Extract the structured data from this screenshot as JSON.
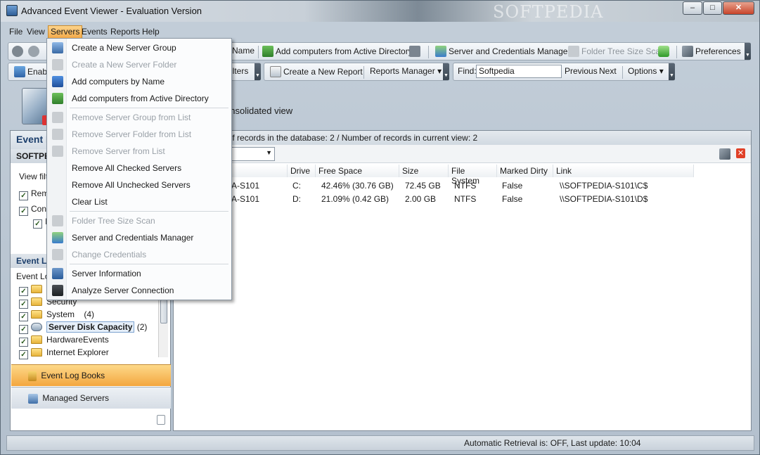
{
  "window": {
    "title": "Advanced Event Viewer - Evaluation Version",
    "watermark": "SOFTPEDIA",
    "buttons": {
      "minimize": "–",
      "maximize": "□",
      "close": "✕"
    }
  },
  "menubar": {
    "items": [
      "File",
      "View",
      "Servers",
      "Events",
      "Reports",
      "Help"
    ],
    "active": "Servers"
  },
  "toolbar1": {
    "name_label": "Name",
    "add_ad": "Add computers from Active Directory",
    "server_cred": "Server and Credentials Manager",
    "folder_scan": "Folder Tree Size Scan",
    "preferences": "Preferences"
  },
  "toolbar2": {
    "enable": "Enable",
    "filters": "ilters",
    "create_report": "Create a New Report",
    "reports_manager": "Reports Manager",
    "find_label": "Find:",
    "find_value": "Softpedia",
    "previous": "Previous",
    "next": "Next",
    "options": "Options"
  },
  "header": {
    "text": "onsolidated view"
  },
  "left": {
    "title": "Event L",
    "subtitle": "SOFTPEDI",
    "view_filter": "View filte",
    "cb1": "Reme",
    "cb2": "Cons",
    "cb3": "I",
    "section": "Event Lo",
    "log_label": "Event Log",
    "tree": [
      {
        "label": "A",
        "count": ""
      },
      {
        "label": "Security",
        "count": ""
      },
      {
        "label": "System",
        "count": "(4)"
      },
      {
        "label": "Server Disk Capacity",
        "count": "(2)"
      },
      {
        "label": "HardwareEvents",
        "count": ""
      },
      {
        "label": "Internet Explorer",
        "count": ""
      }
    ],
    "nav_books": "Event Log Books",
    "nav_servers": "Managed Servers"
  },
  "main": {
    "info": "city:   Number of records in the database: 2 / Number of records in current view: 2",
    "columns": [
      "Drive",
      "Free Space",
      "Size",
      "File System",
      "Marked Dirty",
      "Link"
    ],
    "rows": [
      {
        "server": "DIA-S101",
        "drive": "C:",
        "free": "42.46% (30.76 GB)",
        "size": "72.45 GB",
        "fs": "NTFS",
        "dirty": "False",
        "link": "\\\\SOFTPEDIA-S101\\C$"
      },
      {
        "server": "DIA-S101",
        "drive": "D:",
        "free": "21.09% (0.42 GB)",
        "size": "2.00 GB",
        "fs": "NTFS",
        "dirty": "False",
        "link": "\\\\SOFTPEDIA-S101\\D$"
      }
    ]
  },
  "status": {
    "text": "Automatic Retrieval is: OFF, Last update: 10:04"
  },
  "menu": {
    "items": [
      {
        "label": "Create a New Server Group",
        "disabled": false
      },
      {
        "label": "Create a New Server Folder",
        "disabled": true
      },
      {
        "label": "Add computers by Name",
        "disabled": false
      },
      {
        "label": "Add computers from Active Directory",
        "disabled": false
      },
      {
        "label": "Remove Server Group from List",
        "disabled": true
      },
      {
        "label": "Remove Server Folder from List",
        "disabled": true
      },
      {
        "label": "Remove Server from List",
        "disabled": true
      },
      {
        "label": "Remove All Checked Servers",
        "disabled": false
      },
      {
        "label": "Remove All Unchecked Servers",
        "disabled": false
      },
      {
        "label": "Clear List",
        "disabled": false
      },
      {
        "label": "Folder Tree Size Scan",
        "disabled": true
      },
      {
        "label": "Server and Credentials Manager",
        "disabled": false
      },
      {
        "label": "Change Credentials",
        "disabled": true
      },
      {
        "label": "Server Information",
        "disabled": false
      },
      {
        "label": "Analyze Server Connection",
        "disabled": false
      }
    ]
  }
}
